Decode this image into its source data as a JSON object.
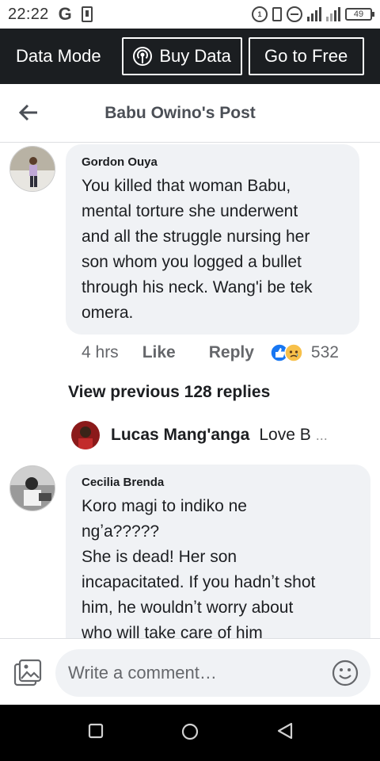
{
  "status_bar": {
    "time": "22:22",
    "g_label": "G",
    "battery": "49"
  },
  "data_bar": {
    "mode_label": "Data Mode",
    "buy_label": "Buy Data",
    "free_label": "Go to Free"
  },
  "header": {
    "title": "Babu Owino's Post"
  },
  "comments": [
    {
      "author": "Gordon Ouya",
      "text": "You killed that woman Babu,\nmental torture she underwent\nand all the struggle nursing her\nson whom you logged a bullet\nthrough his neck. Wang'i be tek\nomera.",
      "time": "4 hrs",
      "like_label": "Like",
      "reply_label": "Reply",
      "reaction_count": "532"
    },
    {
      "author": "Cecilia Brenda",
      "text": "Koro magi to indiko ne\nngʼa?????\nShe is dead! Her son\nincapacitated. If you hadnʼt shot\nhim, he wouldnʼt worry about\nwho will take care of him"
    }
  ],
  "view_previous": "View previous 128 replies",
  "reply_preview": {
    "name": "Lucas Mang'anga",
    "text": "Love B",
    "ellipsis": "..."
  },
  "composer": {
    "placeholder": "Write a comment…"
  },
  "colors": {
    "dark_bar": "#1b1e21",
    "bubble": "#f0f2f5",
    "like_blue": "#1877f2"
  },
  "icons": [
    "back-arrow-icon",
    "antenna-icon",
    "like-reaction-icon",
    "sad-reaction-icon",
    "photo-icon",
    "emoji-icon",
    "recent-apps-icon",
    "home-icon",
    "back-icon"
  ]
}
